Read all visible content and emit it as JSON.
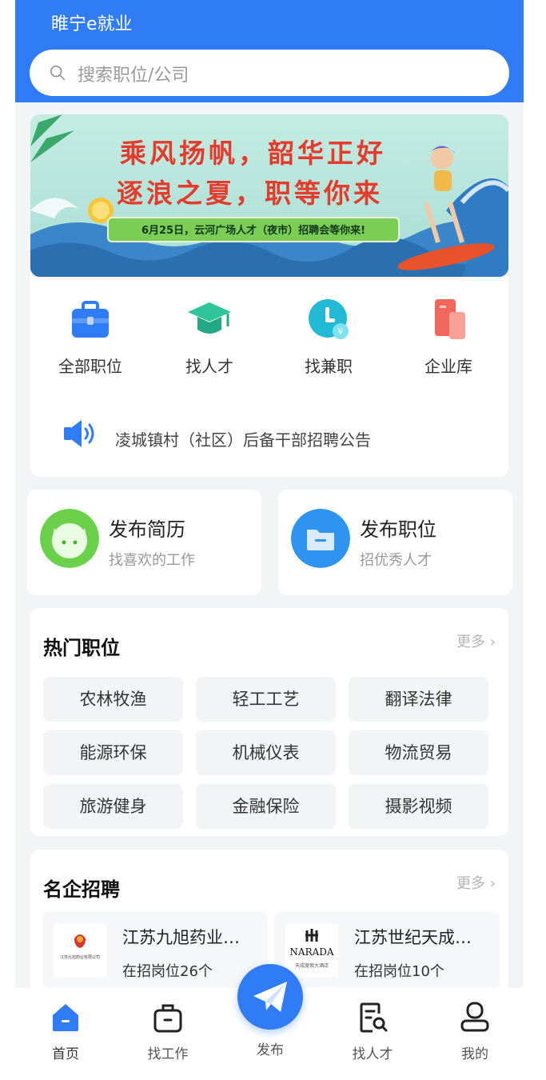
{
  "header": {
    "title": "睢宁e就业",
    "search_placeholder": "搜索职位/公司"
  },
  "banner": {
    "line1": "乘风扬帆，韶华正好",
    "line2": "逐浪之夏，职等你来",
    "subtitle": "6月25日，云河广场人才（夜市）招聘会等你来!"
  },
  "categories": [
    {
      "label": "全部职位",
      "icon": "briefcase-icon"
    },
    {
      "label": "找人才",
      "icon": "graduation-cap-icon"
    },
    {
      "label": "找兼职",
      "icon": "part-time-icon"
    },
    {
      "label": "企业库",
      "icon": "building-icon"
    }
  ],
  "notice": {
    "text": "凌城镇村（社区）后备干部招聘公告",
    "icon": "speaker-icon"
  },
  "publish_cards": [
    {
      "title": "发布简历",
      "subtitle": "找喜欢的工作",
      "icon": "resume-avatar-icon"
    },
    {
      "title": "发布职位",
      "subtitle": "招优秀人才",
      "icon": "folder-icon"
    }
  ],
  "hot_jobs": {
    "title": "热门职位",
    "more": "更多",
    "tags": [
      "农林牧渔",
      "轻工工艺",
      "翻译法律",
      "能源环保",
      "机械仪表",
      "物流贸易",
      "旅游健身",
      "金融保险",
      "摄影视频"
    ]
  },
  "famous_companies": {
    "title": "名企招聘",
    "more": "更多",
    "items": [
      {
        "name": "江苏九旭药业…",
        "positions": "在招岗位26个",
        "logo_text": "江苏九旭药业有限公司"
      },
      {
        "name": "江苏世纪天成…",
        "positions": "在招岗位10个",
        "logo_text": "NARADA",
        "logo_sub": "天成度假大酒店"
      }
    ]
  },
  "tabbar": {
    "tabs": [
      {
        "label": "首页",
        "icon": "home-icon"
      },
      {
        "label": "找工作",
        "icon": "job-bag-icon"
      },
      {
        "label": "发布",
        "icon": "paper-plane-icon"
      },
      {
        "label": "找人才",
        "icon": "talent-search-icon"
      },
      {
        "label": "我的",
        "icon": "user-icon"
      }
    ]
  },
  "colors": {
    "primary": "#2f7cf6",
    "background": "#f3f4f6",
    "muted": "#999999"
  }
}
